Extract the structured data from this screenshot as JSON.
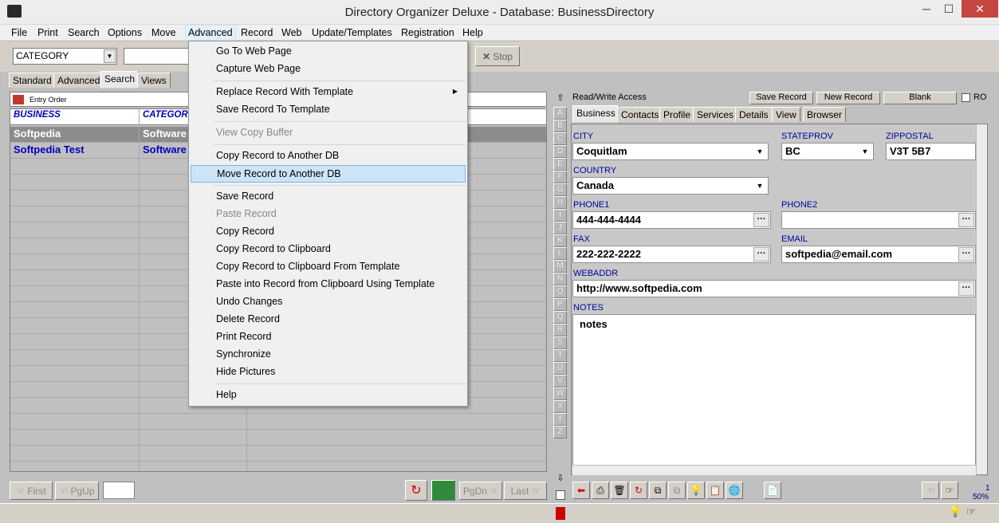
{
  "window": {
    "title": "Directory Organizer Deluxe - Database: BusinessDirectory",
    "minimize": "─",
    "maximize": "☐",
    "close": "✕"
  },
  "menubar": [
    "File",
    "Print",
    "Search",
    "Options",
    "Move",
    "Advanced",
    "Record",
    "Web",
    "Update/Templates",
    "Registration",
    "Help"
  ],
  "toolbar": {
    "category_value": "CATEGORY",
    "search_value": "",
    "stop_label": "Stop"
  },
  "left_tabs": [
    "Standard",
    "Advanced",
    "Search",
    "Views"
  ],
  "entry_order_label": "Entry Order",
  "grid": {
    "columns": [
      "BUSINESS",
      "CATEGORY"
    ],
    "rows": [
      {
        "business": "Softpedia",
        "category": "Software"
      },
      {
        "business": "Softpedia Test",
        "category": "Software"
      }
    ]
  },
  "nav": {
    "first": "First",
    "pgup": "PgUp",
    "pgdn": "PgDn",
    "last": "Last"
  },
  "dropdown_menu": {
    "items": [
      {
        "label": "Go To Web Page"
      },
      {
        "label": "Capture Web Page"
      },
      {
        "label": "Replace Record With Template"
      },
      {
        "label": "Save Record To Template"
      },
      {
        "label": "View Copy Buffer"
      },
      {
        "label": "Copy Record to Another DB"
      },
      {
        "label": "Move Record to Another DB"
      },
      {
        "label": "Save Record"
      },
      {
        "label": "Paste Record"
      },
      {
        "label": "Copy Record"
      },
      {
        "label": "Copy Record to Clipboard"
      },
      {
        "label": "Copy Record to Clipboard From Template"
      },
      {
        "label": "Paste into Record from Clipboard Using Template"
      },
      {
        "label": "Undo Changes"
      },
      {
        "label": "Delete Record"
      },
      {
        "label": "Print Record"
      },
      {
        "label": "Synchronize"
      },
      {
        "label": "Hide Pictures"
      },
      {
        "label": "Help"
      }
    ],
    "submenu_arrow": "▶"
  },
  "alpha_letters": [
    "A",
    "B",
    "C",
    "D",
    "E",
    "F",
    "G",
    "H",
    "I",
    "J",
    "K",
    "L",
    "M",
    "N",
    "O",
    "P",
    "Q",
    "R",
    "S",
    "T",
    "U",
    "V",
    "W",
    "X",
    "Y",
    "Z"
  ],
  "record": {
    "access": "Read/Write Access",
    "save_label": "Save Record",
    "new_label": "New Record",
    "blank_label": "Blank",
    "ro_label": "RO",
    "tabs": [
      "Business",
      "Contacts",
      "Profile",
      "Services",
      "Details",
      "View",
      "Browser"
    ],
    "fields": {
      "city_label": "CITY",
      "city": "Coquitlam",
      "state_label": "STATEPROV",
      "state": "BC",
      "zip_label": "ZIPPOSTAL",
      "zip": "V3T 5B7",
      "country_label": "COUNTRY",
      "country": "Canada",
      "phone1_label": "PHONE1",
      "phone1": "444-444-4444",
      "phone2_label": "PHONE2",
      "phone2": "",
      "fax_label": "FAX",
      "fax": "222-222-2222",
      "email_label": "EMAIL",
      "email": "softpedia@email.com",
      "web_label": "WEBADDR",
      "web": "http://www.softpedia.com",
      "notes_label": "NOTES",
      "notes": "notes"
    }
  },
  "status": {
    "page": "1",
    "zoom": "50%"
  },
  "colors": {
    "accent_blue": "#0000c0",
    "close_red": "#c7463f",
    "highlight": "#cde4f7"
  }
}
